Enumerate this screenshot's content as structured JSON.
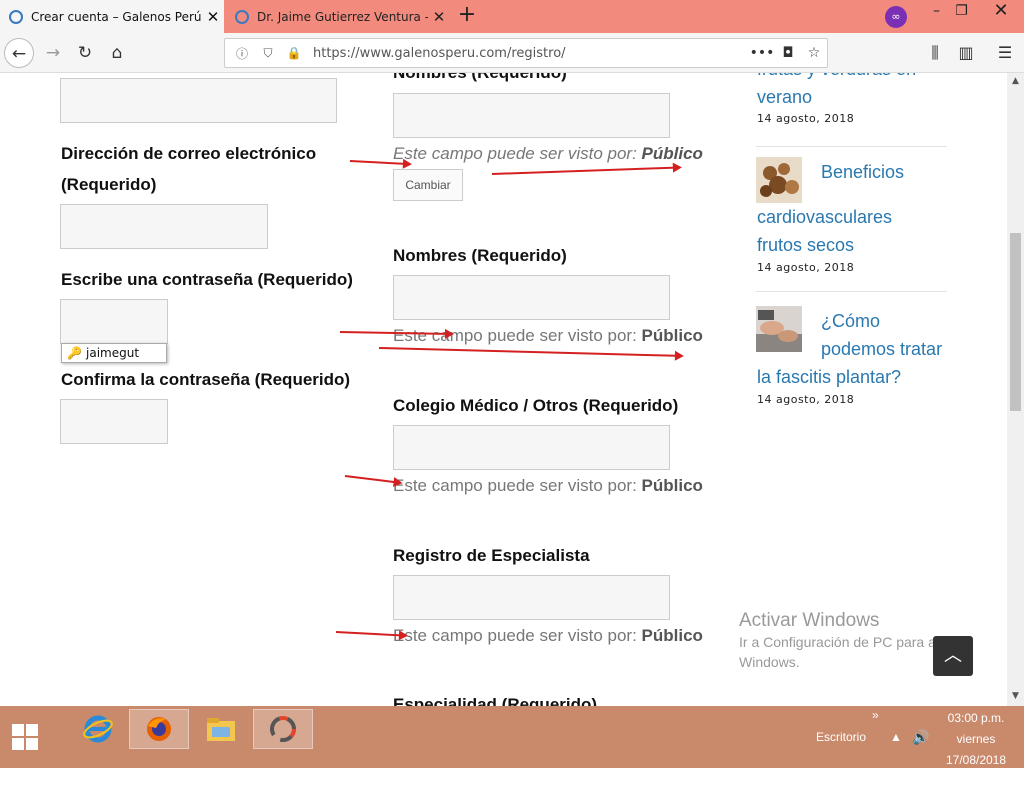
{
  "browser": {
    "tabs": [
      {
        "title": "Crear cuenta – Galenos Perú",
        "close": "✕"
      },
      {
        "title": "Dr. Jaime Gutierrez Ventura - Ga",
        "close": "✕"
      }
    ],
    "new_tab": "+",
    "window_controls": {
      "minimize": "–",
      "maximize": "❐",
      "close": "✕"
    },
    "url": "https://www.galenosperu.com",
    "url_path": "/registro/",
    "more": "•••"
  },
  "form": {
    "left": {
      "email_label_line1": "Dirección de correo electrónico",
      "email_label_line2": "(Requerido)",
      "password_label": "Escribe una contraseña (Requerido)",
      "confirm_label": "Confirma la contraseña (Requerido)",
      "autocomplete_value": "jaimegut"
    },
    "middle": {
      "top_cut_label": "Nombres (Requerido)",
      "visibility_prefix": "Este campo puede ser visto por:",
      "visibility_value": "Público",
      "change_button": "Cambiar",
      "names_label": "Nombres (Requerido)",
      "college_label": "Colegio Médico / Otros (Requerido)",
      "registry_label": "Registro de Especialista",
      "specialty_label": "Especialidad (Requerido)"
    }
  },
  "sidebar": {
    "posts": [
      {
        "title": "frutas y verduras en verano",
        "date": "14 agosto, 2018"
      },
      {
        "title": "Beneficios cardiovasculares frutos secos",
        "date": "14 agosto, 2018"
      },
      {
        "title": "¿Cómo podemos tratar la fascitis plantar?",
        "date": "14 agosto, 2018"
      }
    ]
  },
  "watermark": {
    "title": "Activar Windows",
    "subtitle": "Ir a Configuración de PC para activar Windows."
  },
  "taskbar": {
    "desktop_label": "Escritorio",
    "time": "03:00 p.m.",
    "day": "viernes",
    "date": "17/08/2018",
    "chevron": "»"
  },
  "colors": {
    "tab_bar": "#f28b7d",
    "link": "#2a78b0",
    "annotation_arrow": "#d42020",
    "taskbar": "#c98a6c"
  }
}
